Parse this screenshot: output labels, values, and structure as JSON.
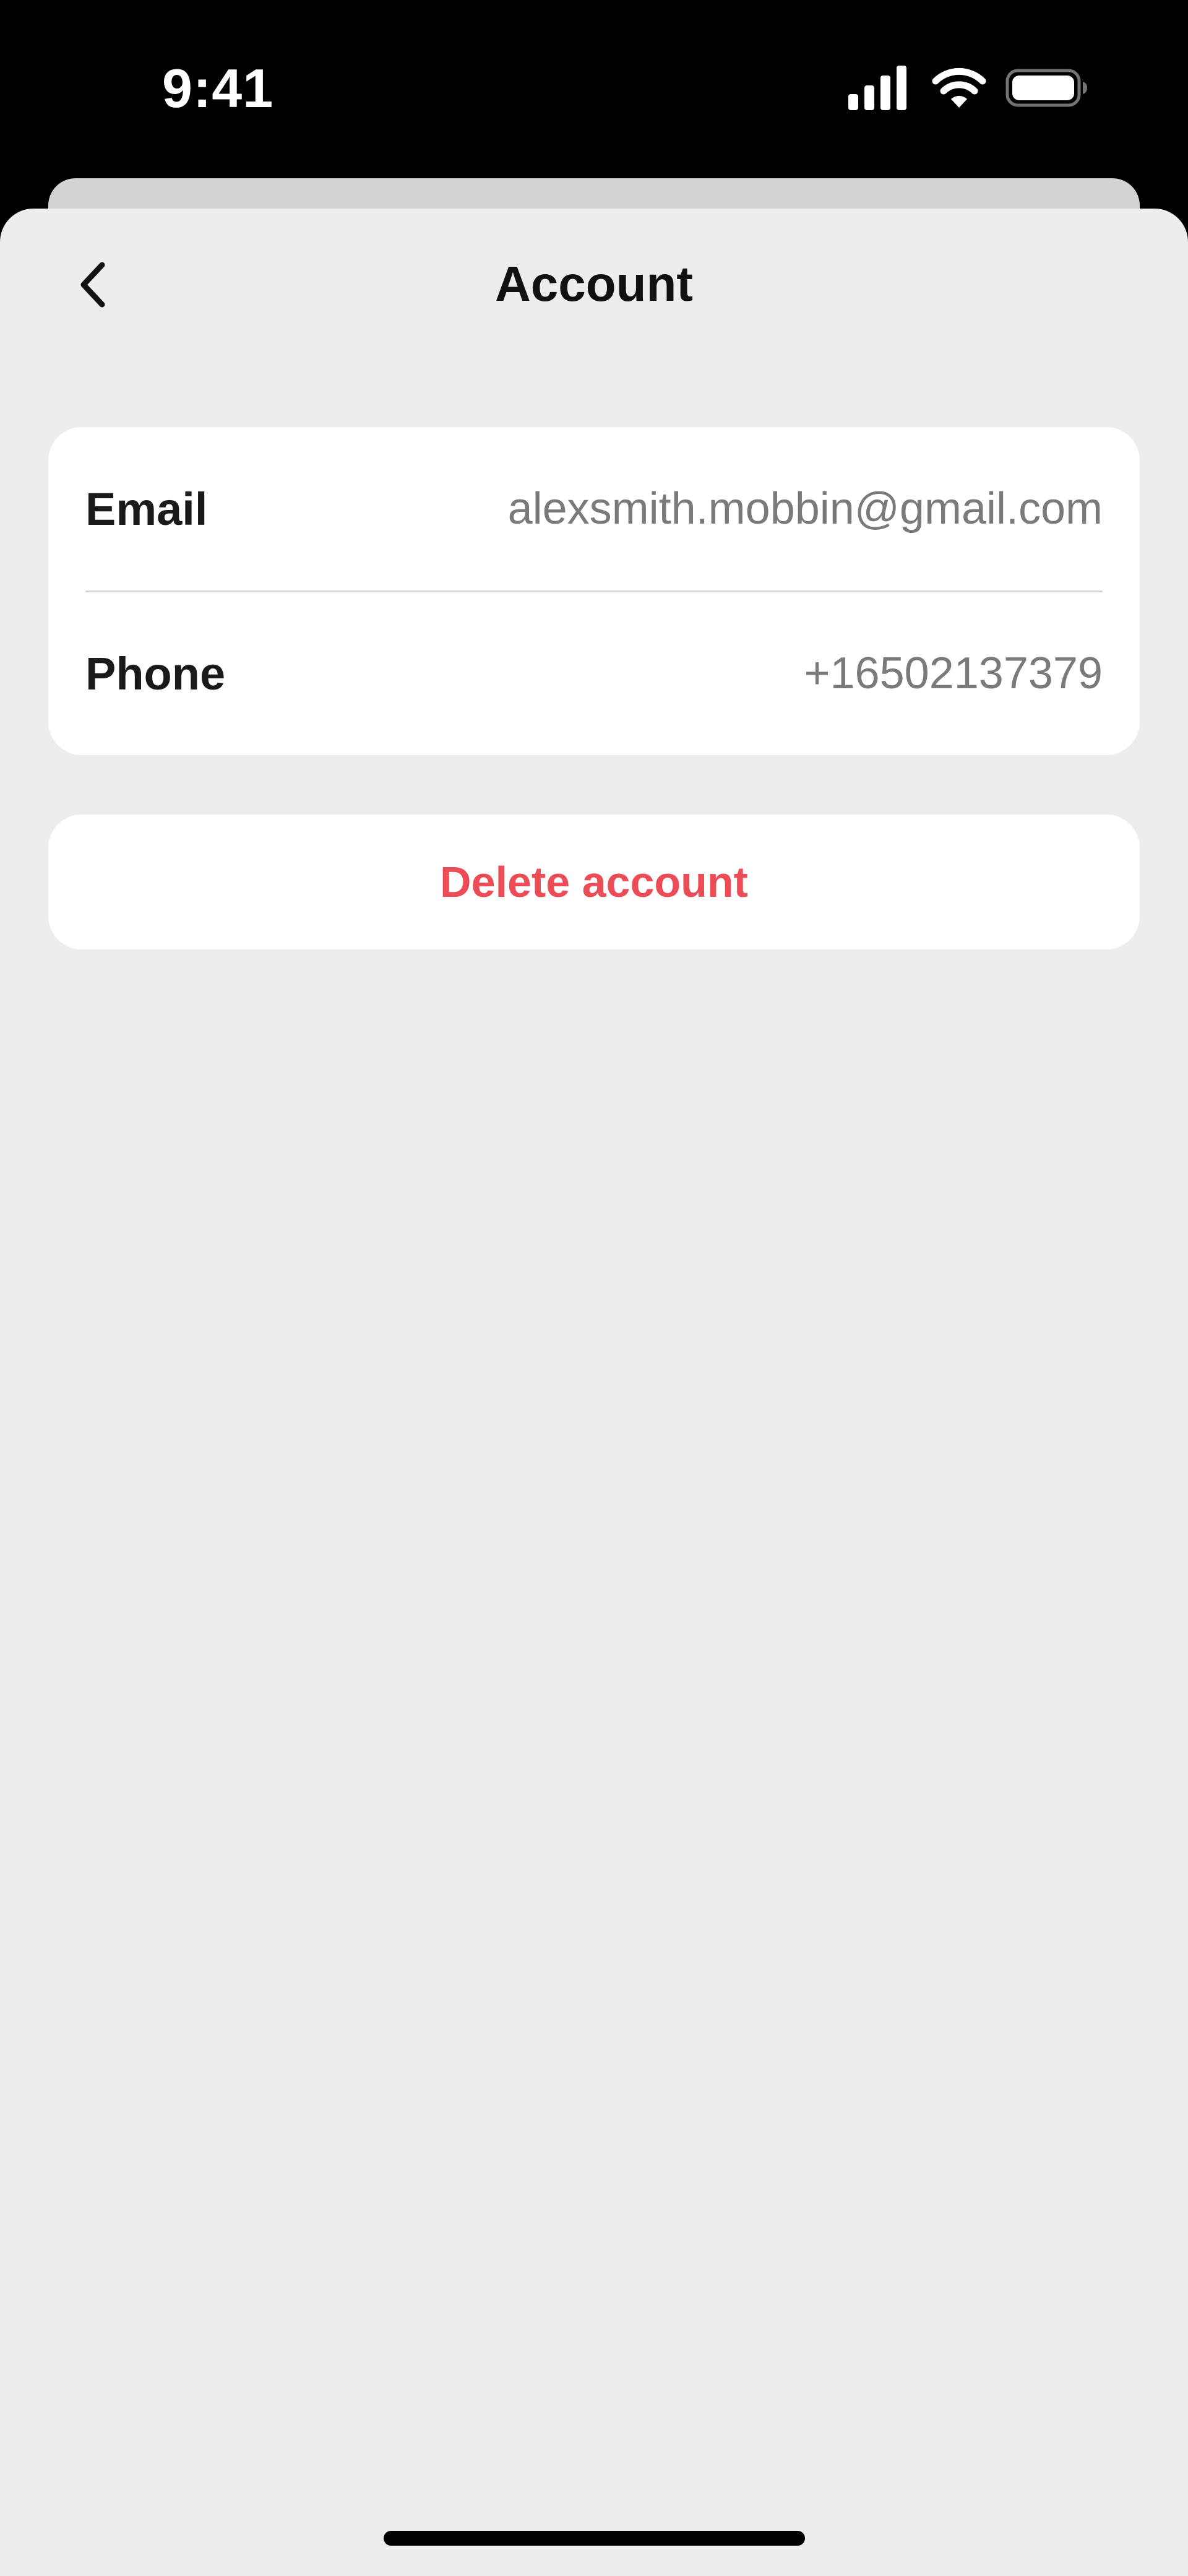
{
  "status_bar": {
    "time": "9:41",
    "icons": [
      "cellular-signal-icon",
      "wifi-icon",
      "battery-icon"
    ]
  },
  "nav": {
    "back_icon": "chevron-left-icon",
    "title": "Account"
  },
  "account": {
    "rows": [
      {
        "label": "Email",
        "value": "alexsmith.mobbin@gmail.com"
      },
      {
        "label": "Phone",
        "value": "+16502137379"
      }
    ]
  },
  "actions": {
    "delete_label": "Delete account"
  },
  "colors": {
    "sheet_background": "#ededed",
    "card_background": "#ffffff",
    "destructive": "#ec4c56",
    "label_text": "#1a1a1a",
    "value_text": "#7a7a7a"
  }
}
